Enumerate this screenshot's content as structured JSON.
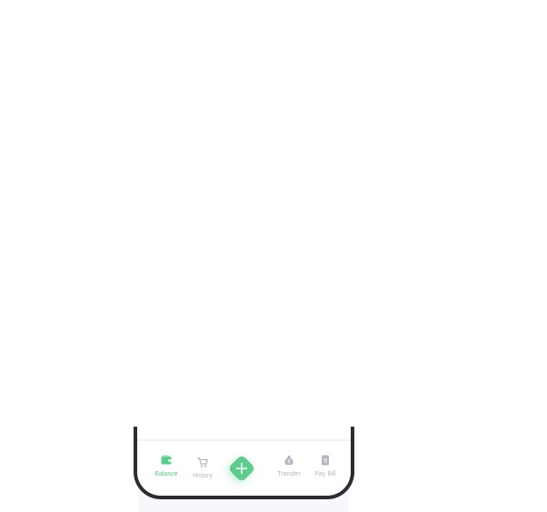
{
  "bottom_nav": {
    "items": [
      {
        "label": "Balance",
        "icon": "wallet-icon",
        "active": true
      },
      {
        "label": "History",
        "icon": "cart-icon",
        "active": false
      },
      {
        "label": "Transfer",
        "icon": "money-bag-icon",
        "active": false
      },
      {
        "label": "Pay Bill",
        "icon": "bill-icon",
        "active": false
      }
    ],
    "fab_icon": "plus-icon"
  },
  "colors": {
    "accent": "#57cf8a",
    "inactive": "#b4b7bd",
    "frame": "#2b2d33"
  }
}
